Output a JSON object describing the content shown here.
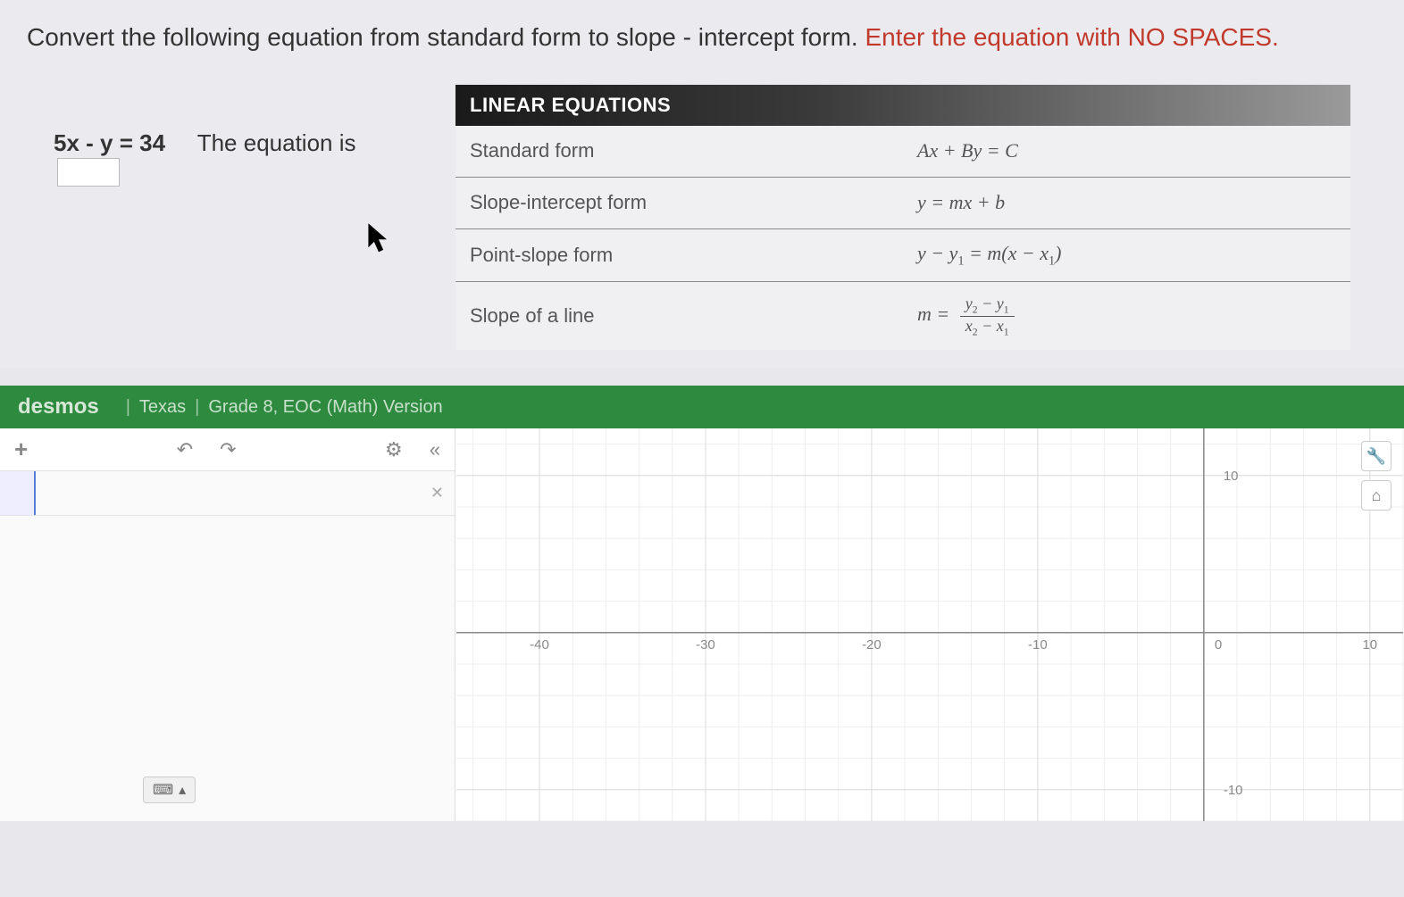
{
  "question": {
    "part1": "Convert the following equation from standard form to slope - intercept form. ",
    "part2_red": "Enter the equation with NO SPACES."
  },
  "problem": {
    "equation": "5x - y = 34",
    "prompt": "The equation is"
  },
  "reference": {
    "title": "LINEAR EQUATIONS",
    "rows": {
      "r1_label": "Standard form",
      "r1_formula": "Ax + By = C",
      "r2_label": "Slope-intercept form",
      "r2_formula": "y = mx + b",
      "r3_label": "Point-slope form",
      "r3_formula_prefix": "y − y",
      "r3_formula_mid": " = m(x − x",
      "r3_formula_suffix": ")",
      "r4_label": "Slope of a line",
      "r4_formula_prefix": "m = ",
      "r4_num_a": "y",
      "r4_num_b": " − y",
      "r4_den_a": "x",
      "r4_den_b": " − x"
    }
  },
  "desmos": {
    "logo": "desmos",
    "region": "Texas",
    "version": "Grade 8, EOC (Math) Version",
    "tools": {
      "plus": "+",
      "undo": "↶",
      "redo": "↷",
      "settings": "⚙",
      "collapse": "«",
      "close_expr": "✕",
      "keyboard": "⌨",
      "keyboard_arrow": "▴",
      "wrench": "🔧",
      "home": "⌂"
    }
  },
  "chart_data": {
    "type": "scatter",
    "title": "",
    "xlabel": "",
    "ylabel": "",
    "xlim": [
      -45,
      12
    ],
    "ylim": [
      -12,
      13
    ],
    "x_ticks": [
      -40,
      -30,
      -20,
      -10,
      0,
      10
    ],
    "y_ticks": [
      -10,
      10
    ],
    "series": []
  }
}
